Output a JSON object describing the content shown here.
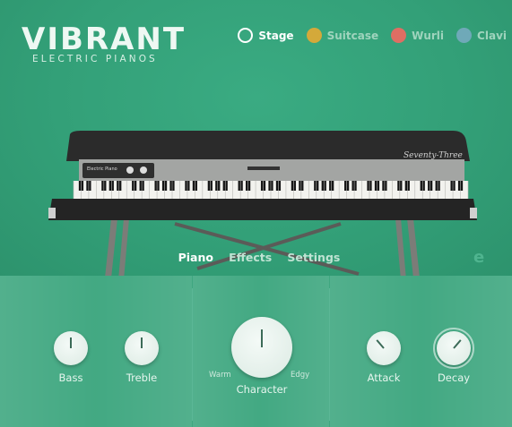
{
  "logo": {
    "title": "VIBRANT",
    "subtitle": "ELECTRIC PIANOS"
  },
  "presets": [
    {
      "label": "Stage",
      "color": "#ffffff",
      "active": true
    },
    {
      "label": "Suitcase",
      "color": "#d4a93a",
      "active": false
    },
    {
      "label": "Wurli",
      "color": "#df6e63",
      "active": false
    },
    {
      "label": "Clavi",
      "color": "#6fa9b8",
      "active": false
    }
  ],
  "piano": {
    "badge": "Electric Piano",
    "script": "Seventy-Three"
  },
  "tabs": [
    "Piano",
    "Effects",
    "Settings"
  ],
  "active_tab": "Piano",
  "controls": {
    "bass": {
      "label": "Bass",
      "level": 0.5
    },
    "treble": {
      "label": "Treble",
      "level": 0.5
    },
    "character": {
      "label": "Character",
      "min_label": "Warm",
      "max_label": "Edgy",
      "level": 0.5
    },
    "attack": {
      "label": "Attack",
      "level": 0.35
    },
    "decay": {
      "label": "Decay",
      "level": 0.65
    }
  },
  "colors": {
    "background": "#2f9a74",
    "panel": "#3fa780"
  }
}
